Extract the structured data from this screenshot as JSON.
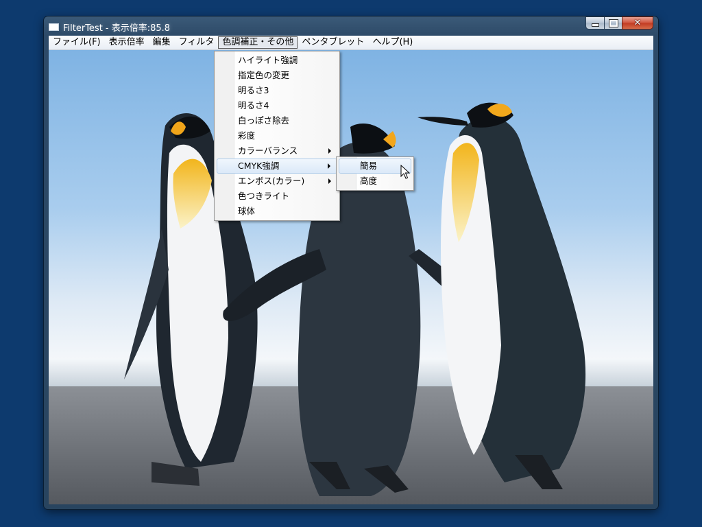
{
  "window": {
    "title": "FilterTest - 表示倍率:85.8",
    "close_glyph": "✕"
  },
  "menubar": {
    "items": [
      "ファイル(F)",
      "表示倍率",
      "編集",
      "フィルタ",
      "色調補正・その他",
      "ペンタブレット",
      "ヘルプ(H)"
    ],
    "active_index": 4
  },
  "dropdown": {
    "items": [
      {
        "label": "ハイライト強調",
        "submenu": false
      },
      {
        "label": "指定色の変更",
        "submenu": false
      },
      {
        "label": "明るさ3",
        "submenu": false
      },
      {
        "label": "明るさ4",
        "submenu": false
      },
      {
        "label": "白っぽさ除去",
        "submenu": false
      },
      {
        "label": "彩度",
        "submenu": false
      },
      {
        "label": "カラーバランス",
        "submenu": true
      },
      {
        "label": "CMYK強調",
        "submenu": true,
        "highlighted": true
      },
      {
        "label": "エンボス(カラー)",
        "submenu": true
      },
      {
        "label": "色つきライト",
        "submenu": false
      },
      {
        "label": "球体",
        "submenu": false
      }
    ]
  },
  "submenu": {
    "items": [
      {
        "label": "簡易",
        "highlighted": true
      },
      {
        "label": "高度"
      }
    ]
  },
  "colors": {
    "desktop": "#0d3a6e",
    "menu_highlight": "#dbe9f8",
    "highlight_border": "#aeccea"
  },
  "icons": {
    "app": "window-icon",
    "minimize": "minimize-icon",
    "maximize": "maximize-icon",
    "close": "close-icon",
    "cursor": "mouse-pointer-icon"
  }
}
